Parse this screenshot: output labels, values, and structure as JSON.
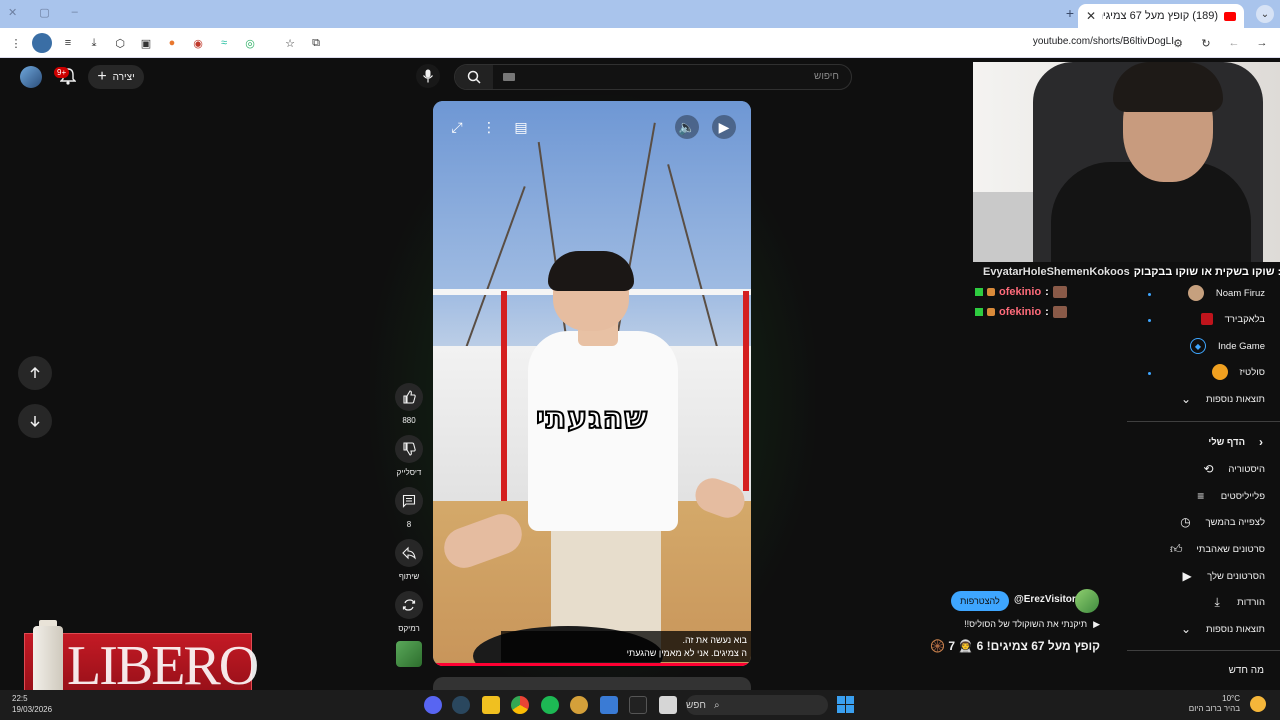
{
  "browser": {
    "tab_title": "(189) קופץ מעל 67 צמיגים! 6",
    "url": "youtube.com/shorts/B6ltivDogLI"
  },
  "yt_header": {
    "create_label": "יצירה",
    "notif_count": "9+",
    "search_placeholder": "חיפוש"
  },
  "video": {
    "caption_big": "שהגעתי",
    "subtitle_line1": "בוא נעשה את זה.",
    "subtitle_line2": "ה צמיגים. אני לא מאמין שהגעתי"
  },
  "actions": {
    "like_count": "880",
    "dislike_label": "דיסלייק",
    "comment_count": "8",
    "share_label": "שיתוף",
    "remix_label": "רמיקס"
  },
  "chat": [
    {
      "user": "EvyatarHoleShemenKokoos",
      "message": "שוקו בשקית או שוקו בבקבוק :",
      "color": "#e0e0e0"
    },
    {
      "user": "ofekinio",
      "message": ":",
      "color": "#ff6b7a"
    },
    {
      "user": "ofekinio",
      "message": ":",
      "color": "#ff6b7a"
    }
  ],
  "sidebar": {
    "subscriptions": [
      "Noam Firuz",
      "בלאקבירד",
      "Inde Game",
      "סולטיז"
    ],
    "more_results_1": "תוצאות נוספות",
    "my_page_title": "הדף שלי",
    "items": [
      "היסטוריה",
      "פלייליסטים",
      "לצפייה בהמשך",
      "סרטונים שאהבתי",
      "הסרטונים שלך",
      "הורדות"
    ],
    "more_results_2": "תוצאות נוספות",
    "whats_new": "מה חדש"
  },
  "short_info": {
    "subscribe_label": "להצטרפות",
    "handle": "@ErezVisitor",
    "music": "תיקנתי את השוקולד של הסוליס!!",
    "title": "קופץ מעל 67 צמיגים! 6 👨‍🚀 7 🛞"
  },
  "ad": {
    "brand": "LIBERO"
  },
  "taskbar": {
    "search_label": "חפש",
    "time": "22:5",
    "date": "19/03/2026",
    "temp": "10°C",
    "weather_text": "בהיר ברוב היום",
    "weather_badge": "3"
  }
}
